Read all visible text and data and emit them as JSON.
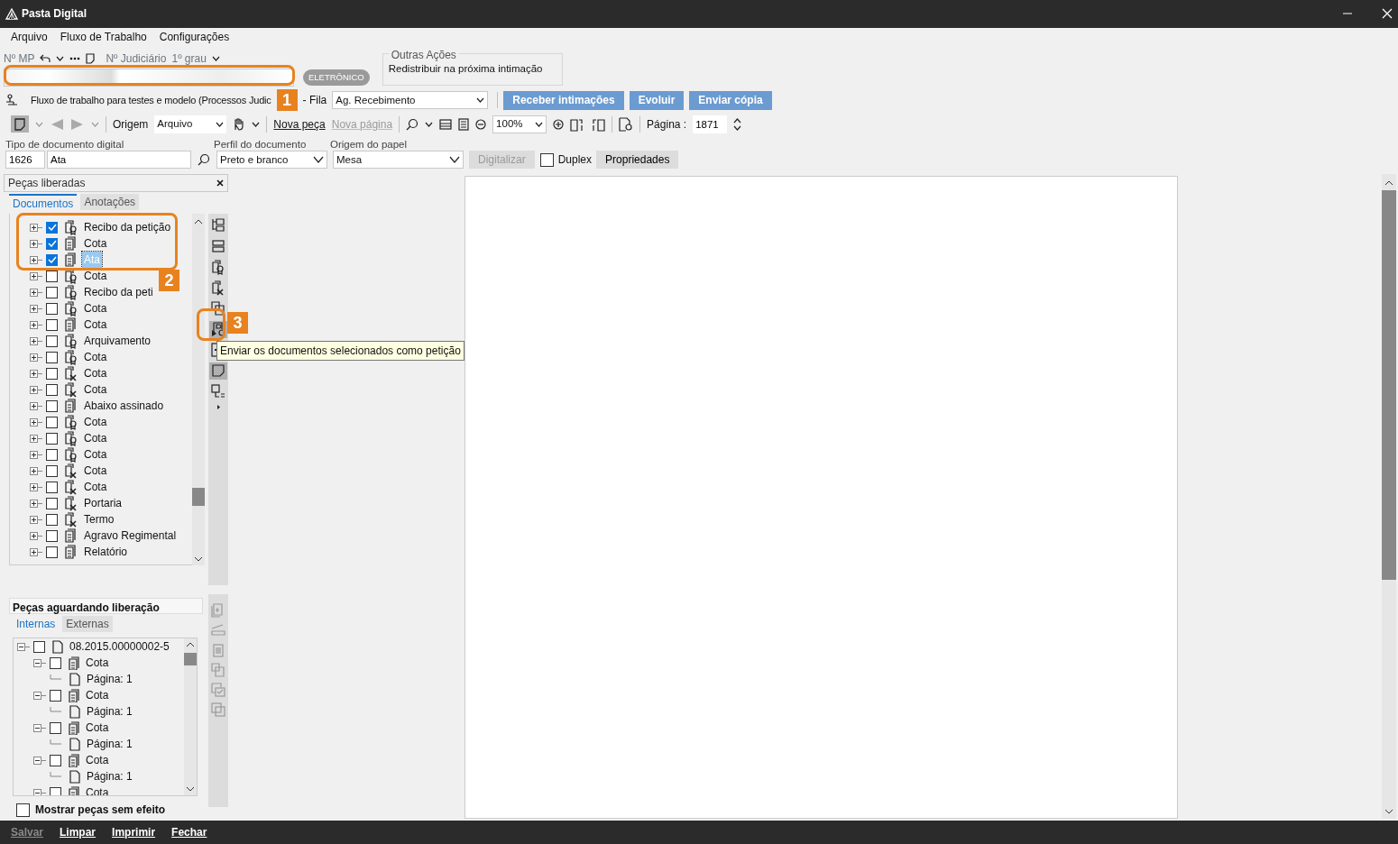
{
  "window": {
    "title": "Pasta Digital"
  },
  "menu": [
    "Arquivo",
    "Fluxo de Trabalho",
    "Configurações"
  ],
  "header": {
    "mp_label": "Nº MP",
    "judicial_label": "Nº Judiciário",
    "instance": "1º grau",
    "badge": "ELETRÔNICO",
    "callout": "1"
  },
  "other_actions": {
    "title": "Outras Ações",
    "items": [
      "Redistribuir na próxima intimação"
    ]
  },
  "workflow": {
    "text": "Fluxo de trabalho para testes e modelo (Processos Judic",
    "queue_label": "- Fila",
    "queue": "Ag. Recebimento",
    "buttons": [
      "Receber intimações",
      "Evoluir",
      "Enviar cópia"
    ]
  },
  "toolbar": {
    "origin_label": "Origem",
    "origin": "Arquivo",
    "actions": [
      {
        "label": "Nova peça",
        "disabled": false
      },
      {
        "label": "Nova página",
        "disabled": true
      }
    ],
    "zoom": "100%",
    "page_label": "Página :",
    "page": "1871"
  },
  "document": {
    "type_label": "Tipo de documento digital",
    "type_code": "1626",
    "type_name": "Ata",
    "profile_label": "Perfil do documento",
    "profile": "Preto e branco",
    "paper_label": "Origem do papel",
    "paper": "Mesa",
    "digitize": {
      "label": "Digitalizar",
      "disabled": true
    },
    "duplex": {
      "label": "Duplex",
      "checked": false
    },
    "properties": "Propriedades"
  },
  "released": {
    "title": "Peças liberadas",
    "tabs": [
      {
        "label": "Documentos",
        "selected": true
      },
      {
        "label": "Anotações",
        "selected": false
      }
    ],
    "callout": "2",
    "items": [
      {
        "label": "Recibo da petição",
        "kind": "seal",
        "checked": true,
        "selected": false
      },
      {
        "label": "Cota",
        "kind": "copy",
        "checked": true,
        "selected": false
      },
      {
        "label": "Ata",
        "kind": "copy",
        "checked": true,
        "selected": true
      },
      {
        "label": "Cota",
        "kind": "seal",
        "checked": false,
        "selected": false
      },
      {
        "label": "Recibo da peti",
        "kind": "seal",
        "checked": false,
        "selected": false
      },
      {
        "label": "Cota",
        "kind": "seal",
        "checked": false,
        "selected": false
      },
      {
        "label": "Cota",
        "kind": "copy",
        "checked": false,
        "selected": false
      },
      {
        "label": "Arquivamento",
        "kind": "seal",
        "checked": false,
        "selected": false
      },
      {
        "label": "Cota",
        "kind": "seal",
        "checked": false,
        "selected": false
      },
      {
        "label": "Cota",
        "kind": "cancel",
        "checked": false,
        "selected": false
      },
      {
        "label": "Cota",
        "kind": "cancel",
        "checked": false,
        "selected": false
      },
      {
        "label": "Abaixo assinado",
        "kind": "copy",
        "checked": false,
        "selected": false
      },
      {
        "label": "Cota",
        "kind": "seal",
        "checked": false,
        "selected": false
      },
      {
        "label": "Cota",
        "kind": "seal",
        "checked": false,
        "selected": false
      },
      {
        "label": "Cota",
        "kind": "seal",
        "checked": false,
        "selected": false
      },
      {
        "label": "Cota",
        "kind": "cancel",
        "checked": false,
        "selected": false
      },
      {
        "label": "Cota",
        "kind": "cancel",
        "checked": false,
        "selected": false
      },
      {
        "label": "Portaria",
        "kind": "cancel",
        "checked": false,
        "selected": false
      },
      {
        "label": "Termo",
        "kind": "cancel",
        "checked": false,
        "selected": false
      },
      {
        "label": "Agravo Regimental",
        "kind": "copy",
        "checked": false,
        "selected": false
      },
      {
        "label": "Relatório",
        "kind": "copy",
        "checked": false,
        "selected": false
      }
    ]
  },
  "side_tools": {
    "callout": "3",
    "tooltip": "Enviar os documentos selecionados como petição"
  },
  "pending": {
    "title": "Peças aguardando liberação",
    "tabs": [
      {
        "label": "Internas",
        "selected": true
      },
      {
        "label": "Externas",
        "selected": false
      }
    ],
    "tree": [
      {
        "label": "08.2015.00000002-5",
        "checked": false,
        "expanded": true,
        "children": [
          {
            "label": "Cota",
            "checked": false,
            "expanded": true,
            "children": [
              {
                "label": "Página: 1"
              }
            ]
          },
          {
            "label": "Cota",
            "checked": false,
            "expanded": true,
            "children": [
              {
                "label": "Página: 1"
              }
            ]
          },
          {
            "label": "Cota",
            "checked": false,
            "expanded": true,
            "children": [
              {
                "label": "Página: 1"
              }
            ]
          },
          {
            "label": "Cota",
            "checked": false,
            "expanded": true,
            "children": [
              {
                "label": "Página: 1"
              }
            ]
          },
          {
            "label": "Cota",
            "checked": false,
            "expanded": true
          }
        ]
      }
    ],
    "show_void": {
      "label": "Mostrar peças sem efeito",
      "checked": false
    }
  },
  "footer": [
    {
      "label": "Salvar",
      "disabled": true
    },
    {
      "label": "Limpar",
      "disabled": false
    },
    {
      "label": "Imprimir",
      "disabled": false
    },
    {
      "label": "Fechar",
      "disabled": false
    }
  ]
}
